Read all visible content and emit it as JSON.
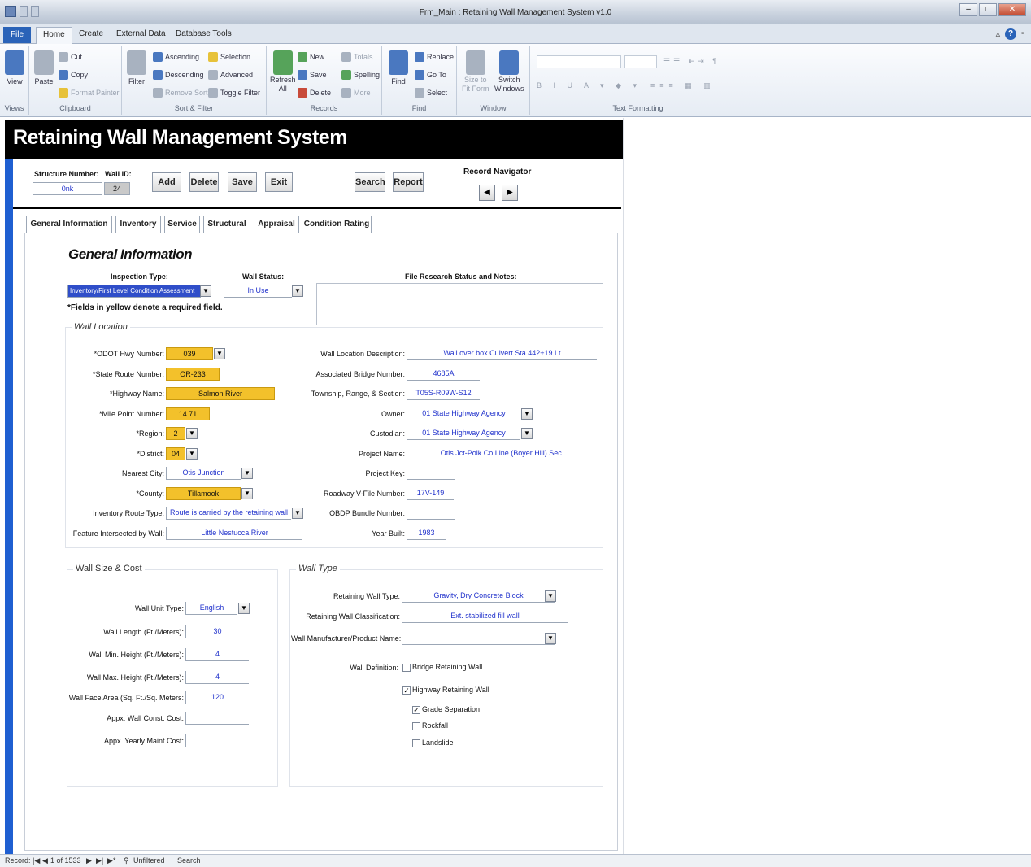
{
  "window": {
    "title": "Frm_Main : Retaining Wall Management System v1.0"
  },
  "ribbon": {
    "file": "File",
    "tabs": [
      "Home",
      "Create",
      "External Data",
      "Database Tools"
    ],
    "groups": {
      "views": {
        "view": "View",
        "label": "Views"
      },
      "clipboard": {
        "paste": "Paste",
        "cut": "Cut",
        "copy": "Copy",
        "format_painter": "Format Painter",
        "label": "Clipboard"
      },
      "sort_filter": {
        "filter": "Filter",
        "ascending": "Ascending",
        "descending": "Descending",
        "remove_sort": "Remove Sort",
        "selection": "Selection",
        "advanced": "Advanced",
        "toggle_filter": "Toggle Filter",
        "label": "Sort & Filter"
      },
      "records": {
        "refresh": "Refresh",
        "refresh2": "All",
        "new": "New",
        "save": "Save",
        "delete": "Delete",
        "totals": "Totals",
        "spelling": "Spelling",
        "more": "More",
        "label": "Records"
      },
      "find": {
        "find": "Find",
        "replace": "Replace",
        "goto": "Go To",
        "select": "Select",
        "label": "Find"
      },
      "window": {
        "size_to": "Size to",
        "fit_form": "Fit Form",
        "switch": "Switch",
        "windows": "Windows",
        "label": "Window"
      },
      "text_formatting": {
        "label": "Text Formatting"
      }
    }
  },
  "form": {
    "title": "Retaining Wall Management System",
    "structure_number_label": "Structure Number:",
    "structure_number": "0nk",
    "wall_id_label": "Wall ID:",
    "wall_id": "24",
    "buttons": {
      "add": "Add",
      "delete": "Delete",
      "save": "Save",
      "exit": "Exit",
      "search": "Search",
      "report": "Report"
    },
    "record_navigator": "Record Navigator",
    "tabs": [
      "General Information",
      "Inventory",
      "Service",
      "Structural",
      "Appraisal",
      "Condition Rating"
    ],
    "section_title": "General Information",
    "inspection_type_label": "Inspection Type:",
    "inspection_type": "Inventory/First Level Condition Assessment",
    "wall_status_label": "Wall Status:",
    "wall_status": "In Use",
    "notes_label": "File Research Status and Notes:",
    "required_note": "*Fields in yellow denote a required field.",
    "wall_location": {
      "title": "Wall Location",
      "left": [
        {
          "label": "*ODOT Hwy Number:",
          "value": "039",
          "required": true,
          "dropdown": true
        },
        {
          "label": "*State Route Number:",
          "value": "OR-233",
          "required": true,
          "dropdown": false
        },
        {
          "label": "*Highway Name:",
          "value": "Salmon River",
          "required": true,
          "dropdown": false
        },
        {
          "label": "*Mile Point Number:",
          "value": "14.71",
          "required": true,
          "dropdown": false
        },
        {
          "label": "*Region:",
          "value": "2",
          "required": true,
          "dropdown": true
        },
        {
          "label": "*District:",
          "value": "04",
          "required": true,
          "dropdown": true
        },
        {
          "label": "Nearest City:",
          "value": "Otis Junction",
          "required": false,
          "dropdown": true
        },
        {
          "label": "*County:",
          "value": "Tillamook",
          "required": true,
          "dropdown": true
        },
        {
          "label": "Inventory Route Type:",
          "value": "Route is carried by the retaining wall",
          "required": false,
          "dropdown": true
        },
        {
          "label": "Feature Intersected by Wall:",
          "value": "Little Nestucca River",
          "required": false,
          "dropdown": false
        }
      ],
      "right": [
        {
          "label": "Wall Location Description:",
          "value": "Wall over box Culvert Sta 442+19 Lt",
          "dropdown": false
        },
        {
          "label": "Associated Bridge Number:",
          "value": "4685A",
          "dropdown": false
        },
        {
          "label": "Township, Range, & Section:",
          "value": "T05S-R09W-S12",
          "dropdown": false
        },
        {
          "label": "Owner:",
          "value": "01 State Highway Agency",
          "dropdown": true
        },
        {
          "label": "Custodian:",
          "value": "01 State Highway Agency",
          "dropdown": true
        },
        {
          "label": "Project Name:",
          "value": "Otis Jct-Polk Co Line (Boyer Hill) Sec.",
          "dropdown": false
        },
        {
          "label": "Project Key:",
          "value": "",
          "dropdown": false
        },
        {
          "label": "Roadway V-File Number:",
          "value": "17V-149",
          "dropdown": false
        },
        {
          "label": "OBDP Bundle Number:",
          "value": "",
          "dropdown": false
        },
        {
          "label": "Year Built:",
          "value": "1983",
          "dropdown": false
        }
      ]
    },
    "wall_size": {
      "title": "Wall Size & Cost",
      "rows": [
        {
          "label": "Wall Unit Type:",
          "value": "English",
          "dropdown": true
        },
        {
          "label": "Wall Length (Ft./Meters):",
          "value": "30",
          "dropdown": false
        },
        {
          "label": "Wall Min. Height (Ft./Meters):",
          "value": "4",
          "dropdown": false
        },
        {
          "label": "Wall Max. Height (Ft./Meters):",
          "value": "4",
          "dropdown": false
        },
        {
          "label": "Wall Face Area (Sq. Ft./Sq. Meters:",
          "value": "120",
          "dropdown": false
        },
        {
          "label": "Appx. Wall Const. Cost:",
          "value": "",
          "dropdown": false
        },
        {
          "label": "Appx. Yearly Maint Cost:",
          "value": "",
          "dropdown": false
        }
      ]
    },
    "wall_type": {
      "title": "Wall Type",
      "rows": [
        {
          "label": "Retaining Wall Type:",
          "value": "Gravity, Dry Concrete Block",
          "dropdown": true
        },
        {
          "label": "Retaining Wall Classification:",
          "value": "Ext. stabilized fill wall",
          "dropdown": false
        },
        {
          "label": "Wall Manufacturer/Product Name:",
          "value": "",
          "dropdown": true
        }
      ],
      "definition_label": "Wall Definition:",
      "checks": [
        {
          "label": "Bridge Retaining Wall",
          "checked": false
        },
        {
          "label": "Highway Retaining Wall",
          "checked": true
        },
        {
          "label": "Grade Separation",
          "checked": true
        },
        {
          "label": "Rockfall",
          "checked": false
        },
        {
          "label": "Landslide",
          "checked": false
        }
      ]
    }
  },
  "statusbar": {
    "record": "Record:",
    "position": "1 of 1533",
    "filter": "Unfiltered",
    "search": "Search"
  }
}
